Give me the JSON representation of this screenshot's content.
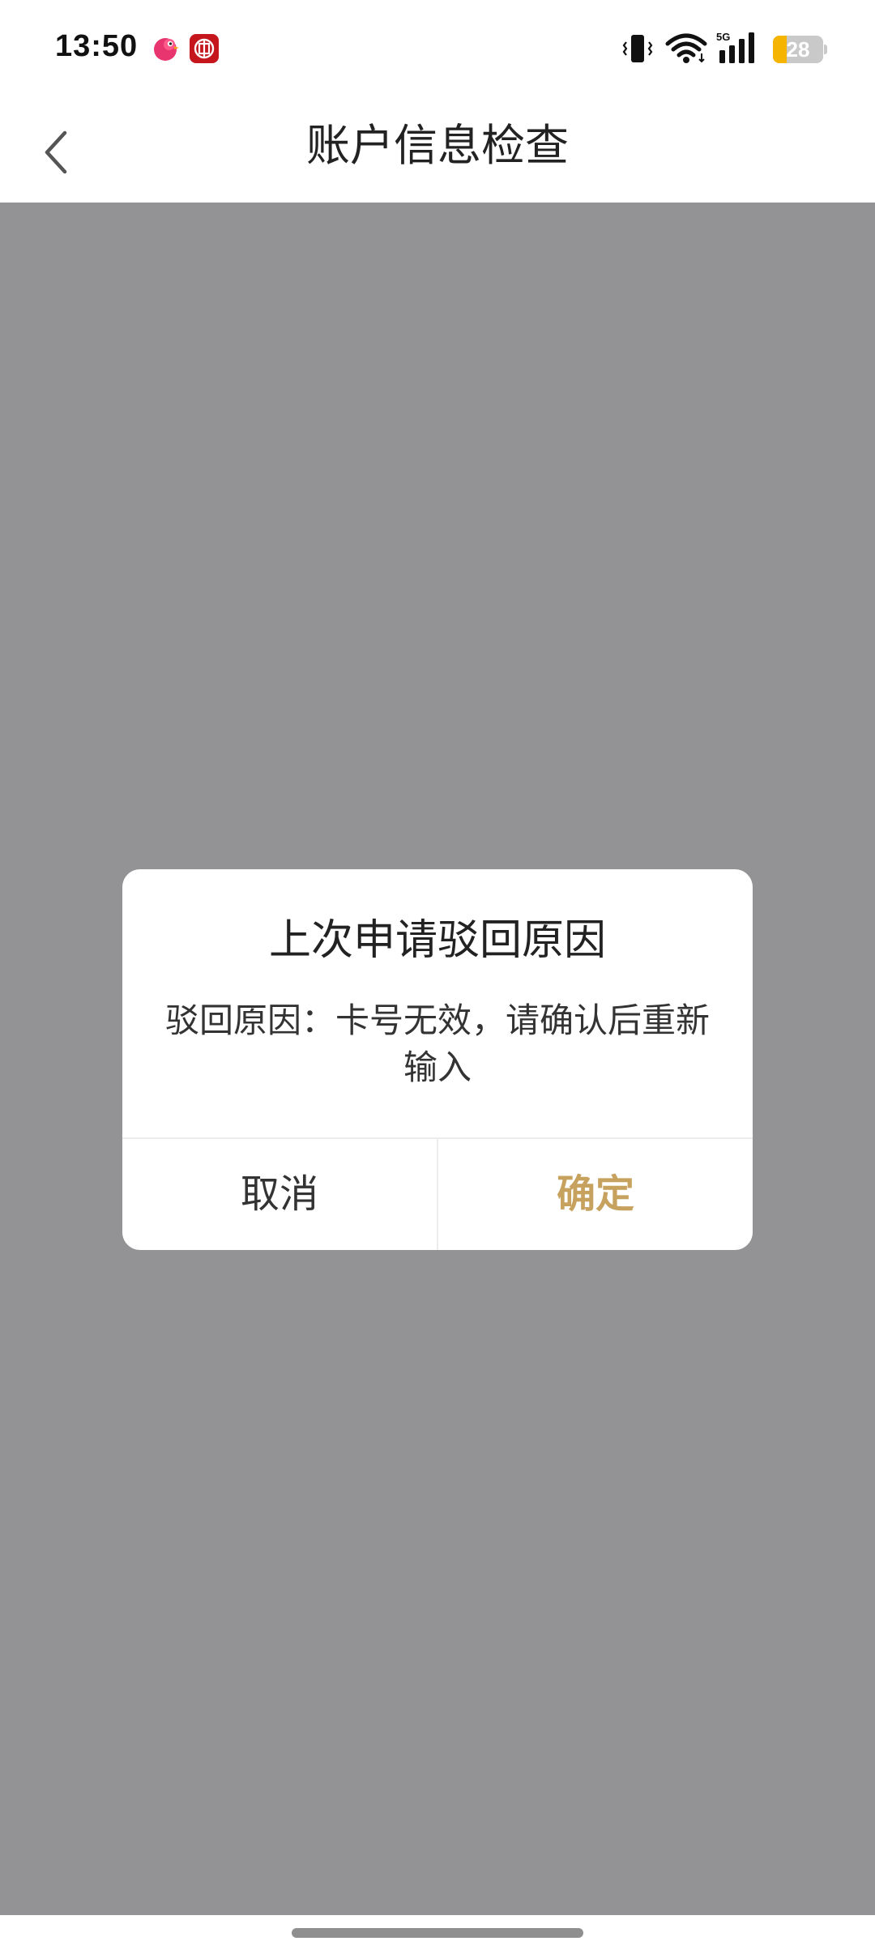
{
  "status_bar": {
    "time": "13:50",
    "notification_icons": [
      "bird-app-icon",
      "bank-app-icon"
    ],
    "network_label": "5G",
    "battery_level": "28",
    "battery_fraction": 0.28,
    "battery_color": "#f5b400"
  },
  "nav": {
    "title": "账户信息检查",
    "back_icon": "chevron-left-icon"
  },
  "overlay": {
    "color": "#939395"
  },
  "dialog": {
    "title": "上次申请驳回原因",
    "message_line1": "驳回原因：卡号无效，请确认后重新",
    "message_line2": "输入",
    "cancel_label": "取消",
    "confirm_label": "确定",
    "confirm_color": "#c7a15e"
  }
}
